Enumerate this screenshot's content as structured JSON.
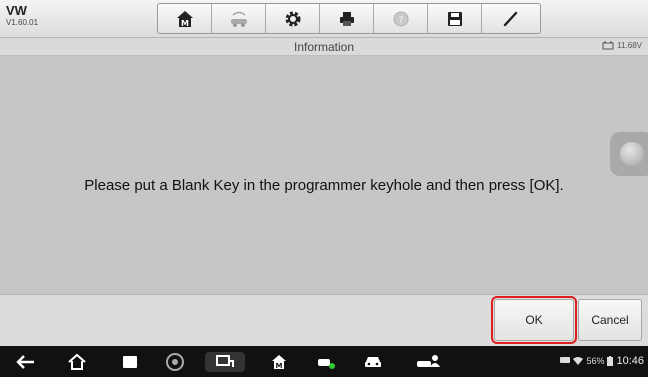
{
  "app": {
    "name": "VW",
    "version": "V1.60.01"
  },
  "toolbar": {
    "items": [
      {
        "icon": "home-m-icon"
      },
      {
        "icon": "vehicle-swap-icon"
      },
      {
        "icon": "gear-icon"
      },
      {
        "icon": "printer-icon"
      },
      {
        "icon": "help-icon"
      },
      {
        "icon": "save-icon"
      },
      {
        "icon": "pen-icon"
      }
    ]
  },
  "header": {
    "title": "Information",
    "battery_voltage": "11.68V"
  },
  "main": {
    "message": "Please put a Blank Key in the programmer keyhole and then press [OK]."
  },
  "buttons": {
    "ok_label": "OK",
    "cancel_label": "Cancel"
  },
  "statusbar": {
    "battery_percent": "56%",
    "time": "10:46"
  },
  "colors": {
    "highlight": "#e02020",
    "background": "#c6c6c6"
  }
}
